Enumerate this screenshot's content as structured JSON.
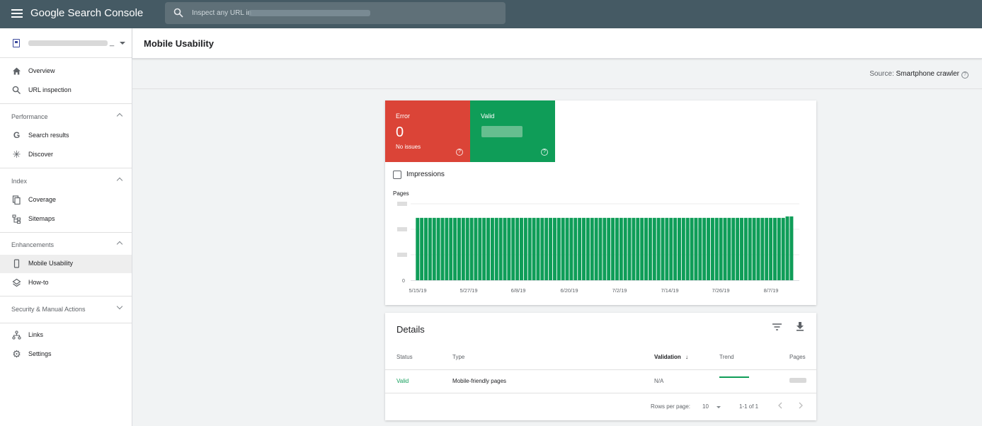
{
  "app": {
    "name": "Google Search Console"
  },
  "search": {
    "placeholder": "Inspect any URL in"
  },
  "property": {
    "suffix": "_"
  },
  "sidebar": {
    "top_items": [
      {
        "label": "Overview",
        "icon": "home-icon"
      },
      {
        "label": "URL inspection",
        "icon": "search-icon"
      }
    ],
    "sections": [
      {
        "label": "Performance",
        "items": [
          {
            "label": "Search results",
            "icon": "google-g-icon"
          },
          {
            "label": "Discover",
            "icon": "asterisk-icon"
          }
        ]
      },
      {
        "label": "Index",
        "items": [
          {
            "label": "Coverage",
            "icon": "pages-icon"
          },
          {
            "label": "Sitemaps",
            "icon": "sitemap-icon"
          }
        ]
      },
      {
        "label": "Enhancements",
        "items": [
          {
            "label": "Mobile Usability",
            "icon": "phone-icon",
            "active": true
          },
          {
            "label": "How-to",
            "icon": "layers-icon"
          }
        ]
      },
      {
        "label": "Security & Manual Actions",
        "items": []
      }
    ],
    "bottom_items": [
      {
        "label": "Links",
        "icon": "links-icon"
      },
      {
        "label": "Settings",
        "icon": "gear-icon"
      }
    ]
  },
  "page": {
    "title": "Mobile Usability",
    "source_prefix": "Source:",
    "source_value": "Smartphone crawler"
  },
  "summary": {
    "error": {
      "label": "Error",
      "value": "0",
      "sub": "No issues",
      "color": "#db4437"
    },
    "valid": {
      "label": "Valid",
      "color": "#0f9d58"
    },
    "impressions_label": "Impressions"
  },
  "chart_data": {
    "type": "bar",
    "ylabel": "Pages",
    "y_tick_labels": [
      "0"
    ],
    "x_tick_labels": [
      "5/15/19",
      "5/27/19",
      "6/8/19",
      "6/20/19",
      "7/2/19",
      "7/14/19",
      "7/26/19",
      "8/7/19"
    ],
    "color": "#0f9d58",
    "series": [
      {
        "values": [
          0.816,
          0.816,
          0.816,
          0.816,
          0.816,
          0.816,
          0.816,
          0.816,
          0.816,
          0.816,
          0.816,
          0.816,
          0.816,
          0.816,
          0.816,
          0.816,
          0.816,
          0.816,
          0.816,
          0.816,
          0.816,
          0.816,
          0.816,
          0.816,
          0.816,
          0.816,
          0.816,
          0.816,
          0.816,
          0.816,
          0.816,
          0.816,
          0.816,
          0.816,
          0.816,
          0.816,
          0.816,
          0.816,
          0.816,
          0.816,
          0.816,
          0.816,
          0.816,
          0.816,
          0.816,
          0.816,
          0.816,
          0.816,
          0.816,
          0.816,
          0.816,
          0.816,
          0.816,
          0.816,
          0.816,
          0.816,
          0.816,
          0.816,
          0.816,
          0.816,
          0.816,
          0.816,
          0.816,
          0.816,
          0.816,
          0.816,
          0.816,
          0.816,
          0.816,
          0.816,
          0.816,
          0.816,
          0.816,
          0.816,
          0.816,
          0.816,
          0.816,
          0.816,
          0.816,
          0.816,
          0.816,
          0.816,
          0.816,
          0.816,
          0.816,
          0.816,
          0.816,
          0.816,
          0.816,
          0.835,
          0.835
        ]
      }
    ],
    "y_range": [
      0,
      1
    ]
  },
  "details": {
    "title": "Details",
    "columns": {
      "status": "Status",
      "type": "Type",
      "validation": "Validation",
      "trend": "Trend",
      "pages": "Pages"
    },
    "rows": [
      {
        "status": "Valid",
        "type": "Mobile-friendly pages",
        "validation": "N/A"
      }
    ],
    "footer": {
      "rows_per_page_label": "Rows per page:",
      "rows_per_page": "10",
      "range": "1-1 of 1"
    }
  }
}
